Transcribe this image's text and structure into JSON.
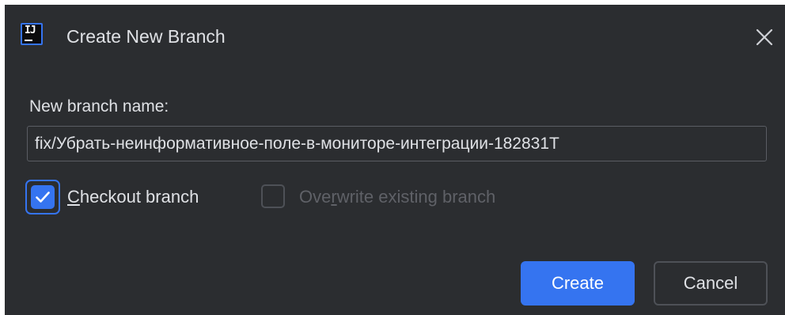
{
  "window": {
    "title": "Create New Branch",
    "app_icon": "intellij-idea-icon",
    "close_icon": "close-icon"
  },
  "form": {
    "label": "New branch name:",
    "branch_name_value": "fix/Убрать-неинформативное-поле-в-мониторе-интеграции-182831T"
  },
  "options": {
    "checkout": {
      "label_mnemonic": "C",
      "label_rest": "heckout branch",
      "checked": true
    },
    "overwrite": {
      "label_before": "Ove",
      "label_mnemonic": "r",
      "label_after": "write existing branch",
      "checked": false,
      "enabled": false
    }
  },
  "buttons": {
    "create": "Create",
    "cancel": "Cancel"
  },
  "colors": {
    "background": "#2b2d30",
    "accent": "#3574f0",
    "text": "#dfe1e5",
    "disabled_text": "#5f6167",
    "border": "#4e5157"
  }
}
